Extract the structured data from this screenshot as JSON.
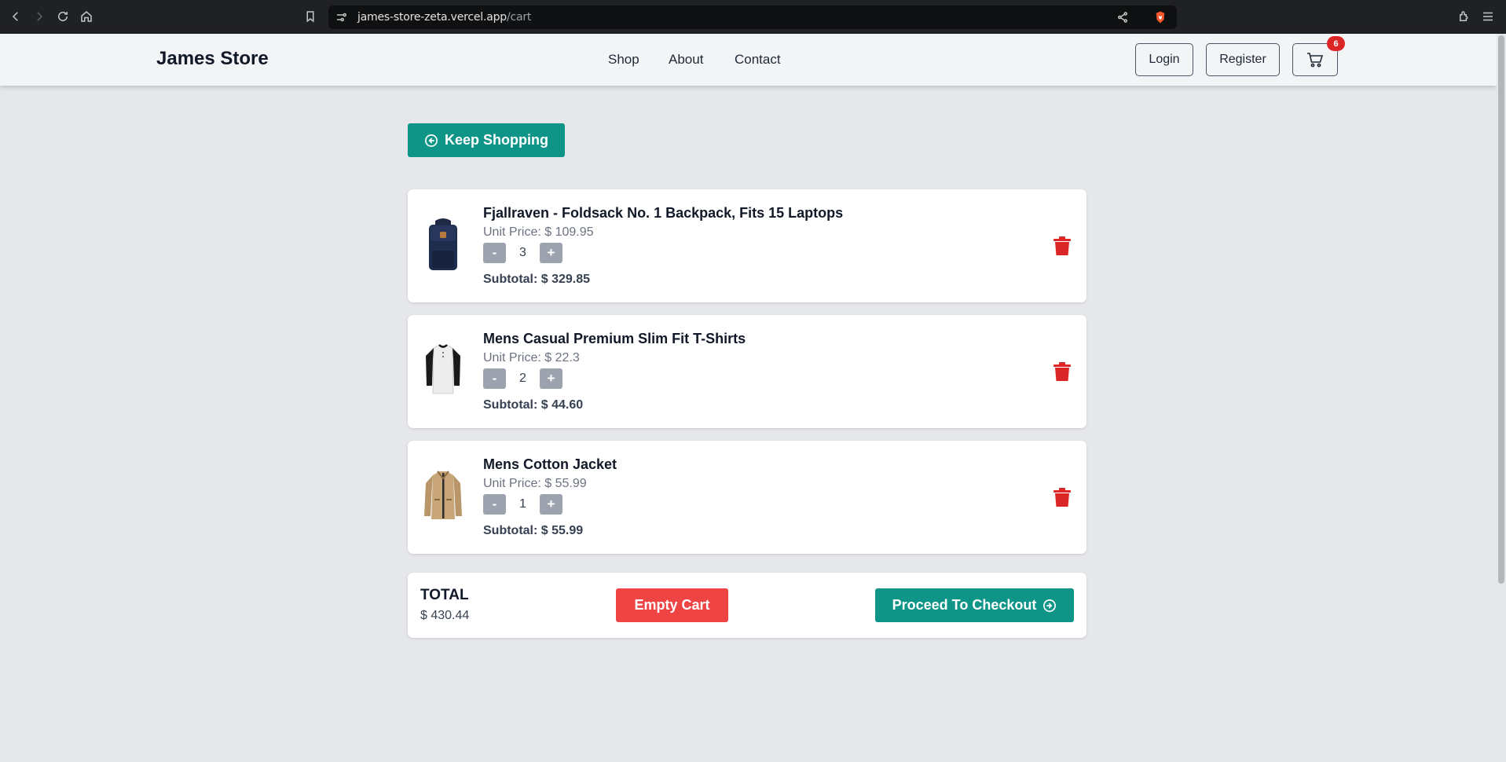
{
  "browser": {
    "url_host": "james-store-zeta.vercel.app",
    "url_path": "/cart"
  },
  "header": {
    "brand": "James Store",
    "nav": [
      "Shop",
      "About",
      "Contact"
    ],
    "login_label": "Login",
    "register_label": "Register",
    "cart_count": "6"
  },
  "keep_shopping_label": "Keep Shopping",
  "items": [
    {
      "name": "Fjallraven - Foldsack No. 1 Backpack, Fits 15 Laptops",
      "unit_price": "Unit Price: $ 109.95",
      "quantity": "3",
      "subtotal": "Subtotal: $ 329.85",
      "image_icon": "backpack-icon"
    },
    {
      "name": "Mens Casual Premium Slim Fit T-Shirts",
      "unit_price": "Unit Price: $ 22.3",
      "quantity": "2",
      "subtotal": "Subtotal: $ 44.60",
      "image_icon": "tshirt-icon"
    },
    {
      "name": "Mens Cotton Jacket",
      "unit_price": "Unit Price: $ 55.99",
      "quantity": "1",
      "subtotal": "Subtotal: $ 55.99",
      "image_icon": "jacket-icon"
    }
  ],
  "qty_minus": "-",
  "qty_plus": "+",
  "total": {
    "label": "TOTAL",
    "value": "$ 430.44"
  },
  "empty_cart_label": "Empty Cart",
  "checkout_label": "Proceed To Checkout",
  "colors": {
    "teal": "#0f9488",
    "red": "#ef4444",
    "trash_red": "#dc2626",
    "page_bg": "#e5e7eb"
  }
}
